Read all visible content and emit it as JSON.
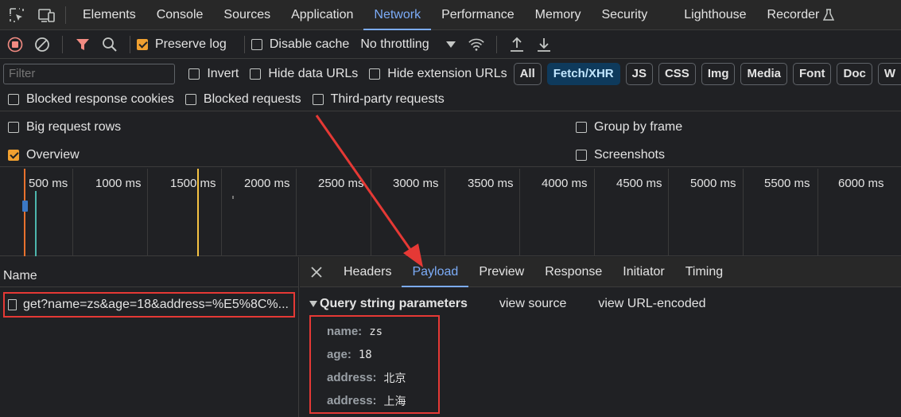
{
  "main_tabs": [
    "Elements",
    "Console",
    "Sources",
    "Application",
    "Network",
    "Performance",
    "Memory",
    "Security",
    "Lighthouse",
    "Recorder"
  ],
  "active_tab": "Network",
  "toolbar": {
    "preserve_log": "Preserve log",
    "disable_cache": "Disable cache",
    "throttling": "No throttling"
  },
  "filter": {
    "placeholder": "Filter",
    "invert": "Invert",
    "hide_data_urls": "Hide data URLs",
    "hide_extension_urls": "Hide extension URLs",
    "types": [
      "All",
      "Fetch/XHR",
      "JS",
      "CSS",
      "Img",
      "Media",
      "Font",
      "Doc",
      "W"
    ],
    "active_type": "Fetch/XHR"
  },
  "options": {
    "blocked_response_cookies": "Blocked response cookies",
    "blocked_requests": "Blocked requests",
    "third_party_requests": "Third-party requests",
    "big_request_rows": "Big request rows",
    "group_by_frame": "Group by frame",
    "overview": "Overview",
    "screenshots": "Screenshots"
  },
  "timeline": {
    "ticks": [
      "500 ms",
      "1000 ms",
      "1500 ms",
      "2000 ms",
      "2500 ms",
      "3000 ms",
      "3500 ms",
      "4000 ms",
      "4500 ms",
      "5000 ms",
      "5500 ms",
      "6000 ms"
    ]
  },
  "request_list": {
    "header": "Name",
    "request": "get?name=zs&age=18&address=%E5%8C%..."
  },
  "detail": {
    "tabs": [
      "Headers",
      "Payload",
      "Preview",
      "Response",
      "Initiator",
      "Timing"
    ],
    "active_tab": "Payload",
    "section_title": "Query string parameters",
    "view_source": "view source",
    "view_url_encoded": "view URL-encoded",
    "params": [
      {
        "key": "name:",
        "value": "zs"
      },
      {
        "key": "age:",
        "value": "18"
      },
      {
        "key": "address:",
        "value": "北京"
      },
      {
        "key": "address:",
        "value": "上海"
      }
    ]
  },
  "colors": {
    "accent": "#7cacf8",
    "highlight": "#e53935",
    "checkbox": "#f0a030"
  }
}
